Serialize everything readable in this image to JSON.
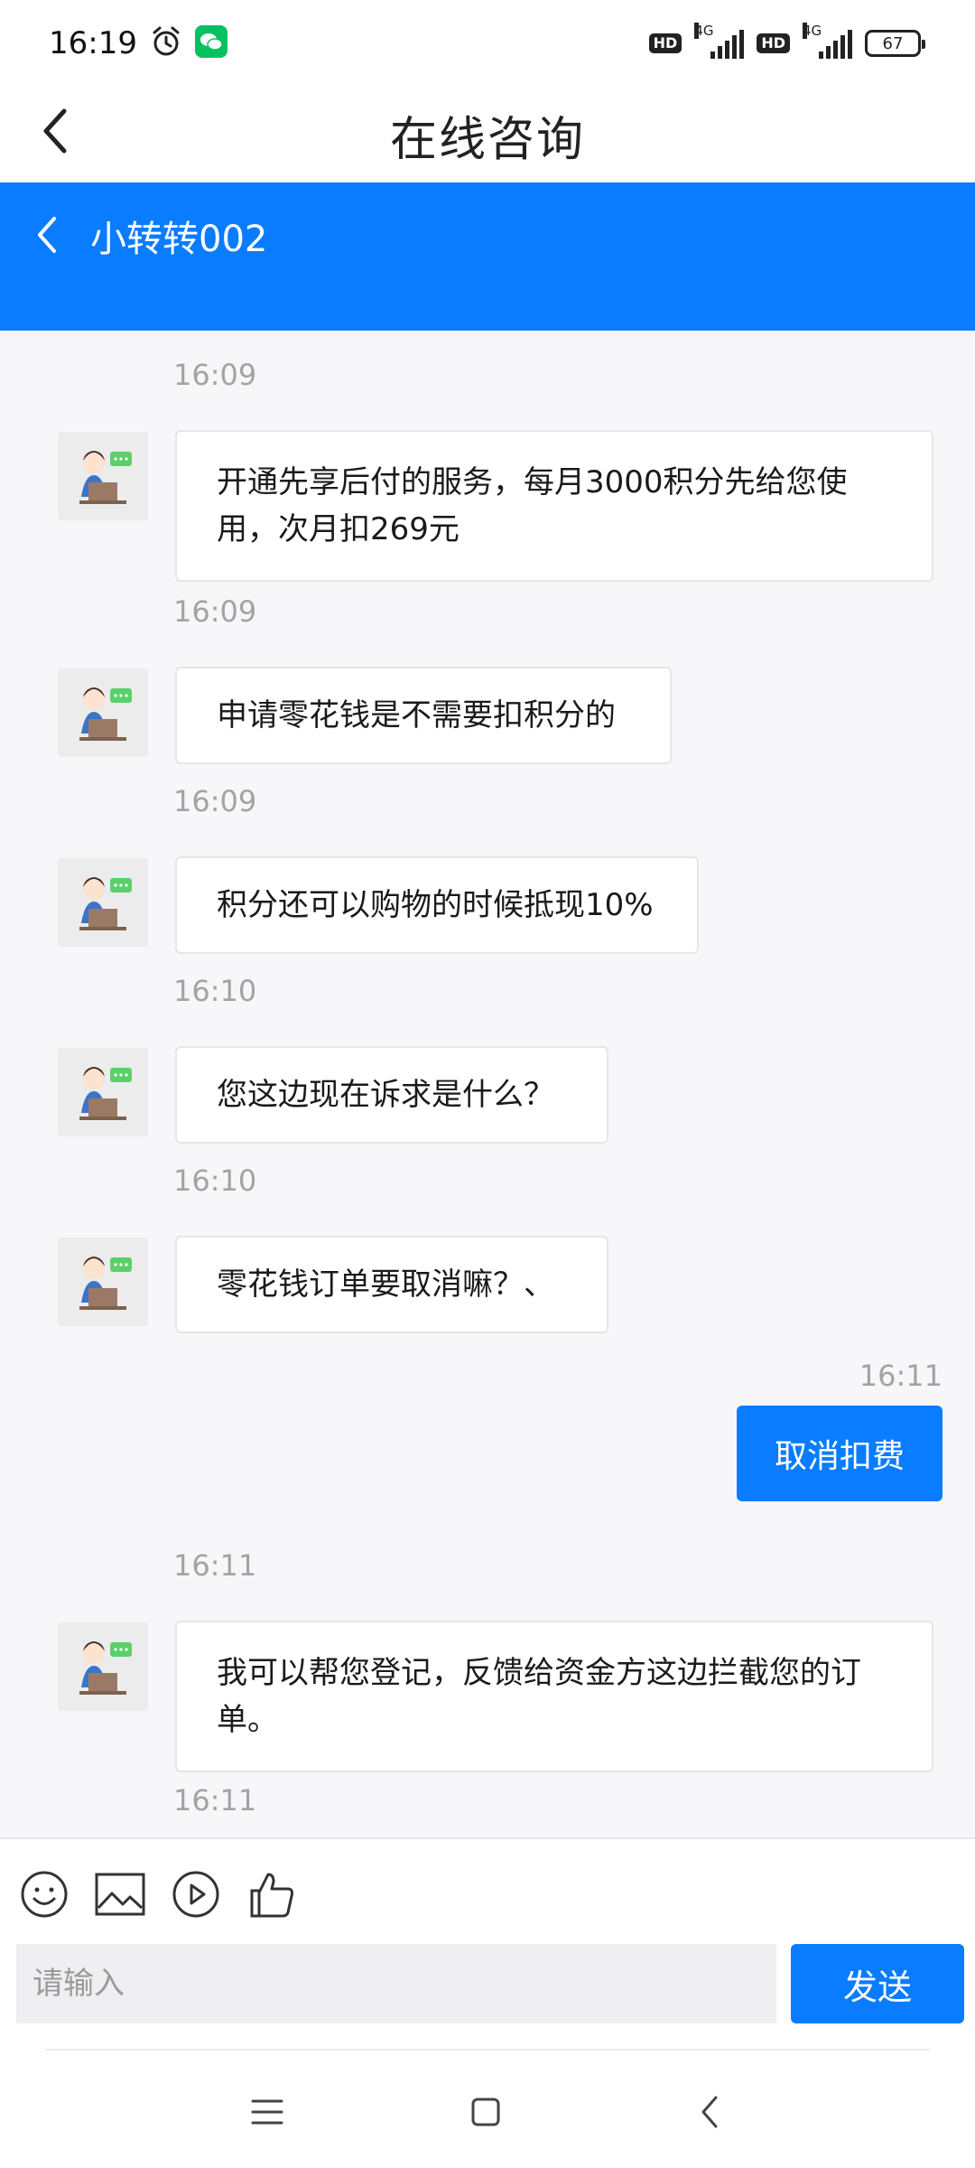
{
  "status_bar": {
    "time": "16:19",
    "network_1": "4G",
    "network_2": "4G",
    "hd_1": "HD",
    "hd_2": "HD",
    "battery": "67"
  },
  "header": {
    "title": "在线咨询"
  },
  "agent_bar": {
    "name": "小转转002"
  },
  "messages": [
    {
      "time": "16:09",
      "text_lines": [
        "开通先享后付的服务，每月3000积分先给您使",
        "用，次月扣269元"
      ],
      "sender": "agent"
    },
    {
      "time": "16:09",
      "text": "申请零花钱是不需要扣积分的",
      "sender": "agent"
    },
    {
      "time": "16:09",
      "text": "积分还可以购物的时候抵现10%",
      "sender": "agent"
    },
    {
      "time": "16:10",
      "text": "您这边现在诉求是什么？",
      "sender": "agent"
    },
    {
      "time": "16:10",
      "text": "零花钱订单要取消嘛？、",
      "sender": "agent"
    },
    {
      "time": "16:11",
      "text": "取消扣费",
      "sender": "me"
    },
    {
      "time": "16:11",
      "text_lines": [
        "我可以帮您登记，反馈给资金方这边拦截您的订",
        "单。"
      ],
      "sender": "agent"
    },
    {
      "time": "16:11",
      "text": "",
      "sender": "agent"
    }
  ],
  "input": {
    "placeholder": "请输入",
    "value": "",
    "send_label": "发送"
  },
  "icons": {
    "toolbar": [
      "emoji-icon",
      "image-icon",
      "video-icon",
      "thumbs-up-icon"
    ],
    "nav": [
      "menu-icon",
      "home-icon",
      "back-icon"
    ]
  },
  "colors": {
    "accent": "#0a7cff",
    "chat_bg": "#f7f7f9",
    "timestamp": "#a3a3a3"
  }
}
